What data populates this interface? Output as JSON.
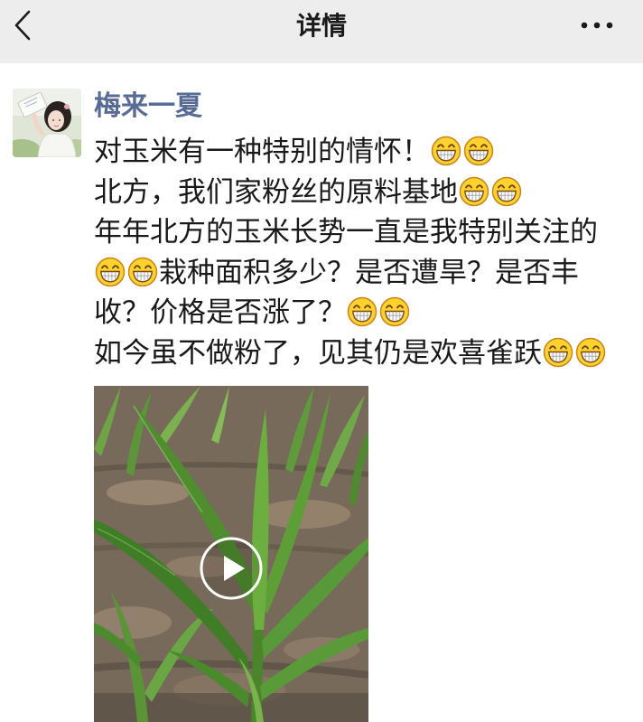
{
  "header": {
    "title": "详情",
    "back_icon": "chevron-left-icon",
    "more_icon": "more-dots-icon"
  },
  "post": {
    "author": "梅来一夏",
    "avatar_icon": "avatar",
    "emoji_icon": "grin-emoji-icon",
    "lines": [
      [
        {
          "text": "对玉米有一种特别的情怀！"
        },
        {
          "emoji": "grin"
        },
        {
          "emoji": "grin"
        }
      ],
      [
        {
          "text": "北方，我们家粉丝的原料基地"
        },
        {
          "emoji": "grin"
        },
        {
          "emoji": "grin"
        }
      ],
      [
        {
          "text": "年年北方的玉米长势一直是我特别关注的"
        }
      ],
      [
        {
          "emoji": "grin"
        },
        {
          "emoji": "grin"
        },
        {
          "text": "栽种面积多少？是否遭旱？是否丰"
        }
      ],
      [
        {
          "text": "收？价格是否涨了？"
        },
        {
          "emoji": "grin"
        },
        {
          "emoji": "grin"
        }
      ],
      [
        {
          "text": "如今虽不做粉了，见其仍是欢喜雀跃"
        },
        {
          "emoji": "grin"
        },
        {
          "emoji": "grin"
        }
      ]
    ],
    "video": {
      "thumbnail": "corn-field",
      "play_icon": "play-icon"
    }
  },
  "colors": {
    "header_bg": "#ededed",
    "author": "#576b95",
    "text": "#191919"
  }
}
